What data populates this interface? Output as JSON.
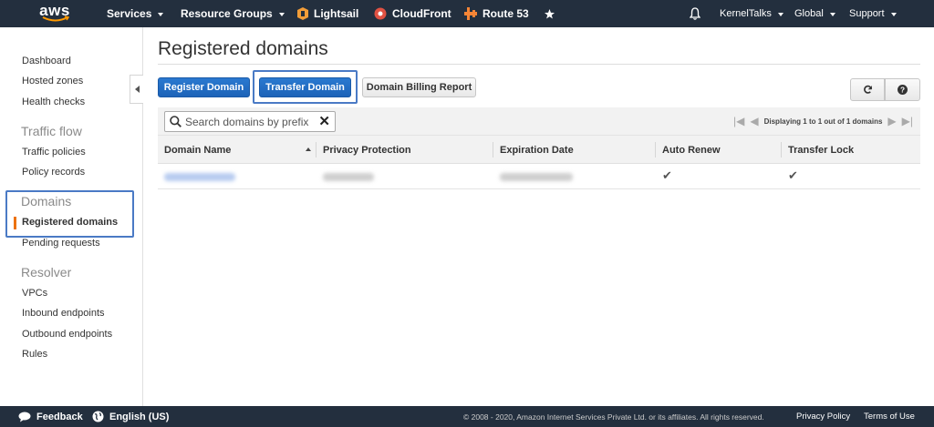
{
  "topnav": {
    "logo": "aws",
    "services": "Services",
    "resource_groups": "Resource Groups",
    "lightsail": "Lightsail",
    "cloudfront": "CloudFront",
    "route53": "Route 53",
    "user": "KernelTalks",
    "region": "Global",
    "support": "Support",
    "colors": {
      "lightsail": "#f29d38",
      "cloudfront": "#e05243",
      "route53": "#f58536",
      "nav_bg": "#232f3e"
    }
  },
  "sidebar": {
    "dashboard": "Dashboard",
    "hosted_zones": "Hosted zones",
    "health_checks": "Health checks",
    "traffic_flow_header": "Traffic flow",
    "traffic_policies": "Traffic policies",
    "policy_records": "Policy records",
    "domains_header": "Domains",
    "registered_domains": "Registered domains",
    "pending_requests": "Pending requests",
    "resolver_header": "Resolver",
    "vpcs": "VPCs",
    "inbound_endpoints": "Inbound endpoints",
    "outbound_endpoints": "Outbound endpoints",
    "rules": "Rules",
    "selected_color": "#ec7211"
  },
  "main": {
    "title": "Registered domains",
    "register_button": "Register Domain",
    "transfer_button": "Transfer Domain",
    "billing_button": "Domain Billing Report",
    "search_placeholder": "Search domains by prefix",
    "pager_text": "Displaying 1 to 1 out of 1 domains",
    "columns": [
      "Domain Name",
      "Privacy Protection",
      "Expiration Date",
      "Auto Renew",
      "Transfer Lock"
    ]
  },
  "footer": {
    "feedback": "Feedback",
    "language": "English (US)",
    "copyright": "© 2008 - 2020, Amazon Internet Services Private Ltd. or its affiliates. All rights reserved.",
    "privacy": "Privacy Policy",
    "terms": "Terms of Use"
  }
}
